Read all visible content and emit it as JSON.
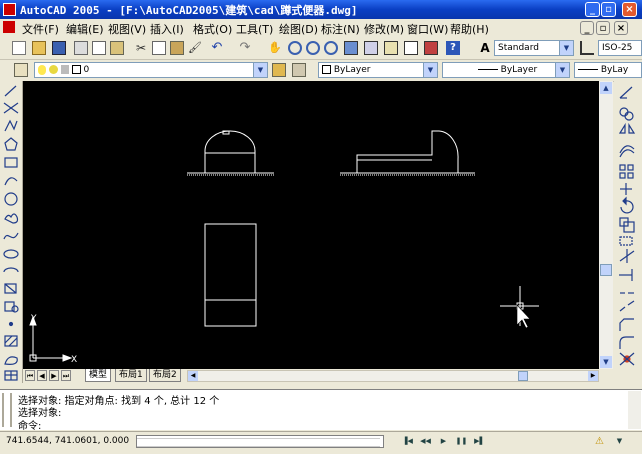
{
  "window": {
    "title": "AutoCAD 2005 - [F:\\AutoCAD2005\\建筑\\cad\\蹲式便器.dwg]"
  },
  "menu": [
    "文件(F)",
    "编辑(E)",
    "视图(V)",
    "插入(I)",
    "格式(O)",
    "工具(T)",
    "绘图(D)",
    "标注(N)",
    "修改(M)",
    "窗口(W)",
    "帮助(H)"
  ],
  "toolbar": {
    "text_style": "Standard",
    "dim_style": "ISO-25"
  },
  "layers": {
    "current_layer": "0",
    "color": "ByLayer",
    "linetype": "ByLayer",
    "lineweight": "ByLay"
  },
  "ucs": {
    "x": "X",
    "y": "Y"
  },
  "tabs": [
    "模型",
    "布局1",
    "布局2"
  ],
  "command": {
    "line1": "选择对象: 指定对角点: 找到 4 个, 总计 12 个",
    "line2": "选择对象:",
    "prompt": "命令:"
  },
  "status": {
    "coords": "741.6544, 741.0601, 0.000"
  }
}
